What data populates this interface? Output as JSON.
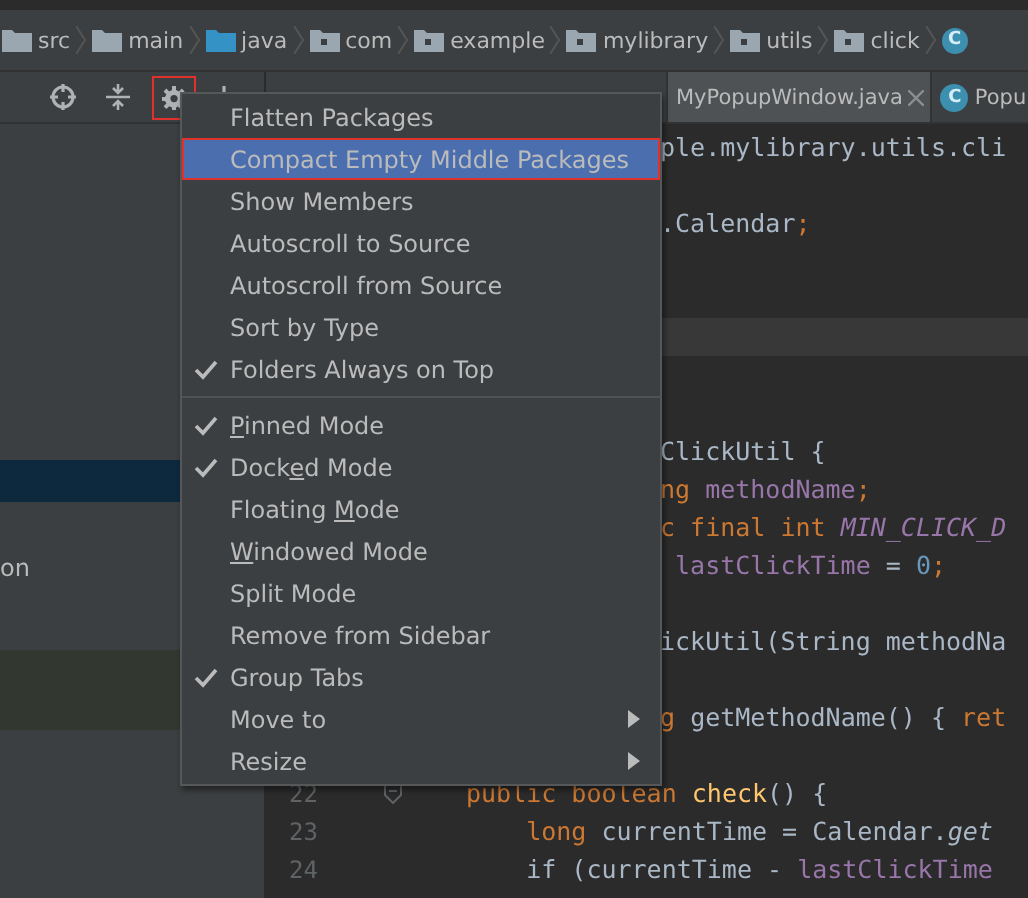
{
  "breadcrumb": [
    {
      "label": "src",
      "kind": "folder"
    },
    {
      "label": "main",
      "kind": "folder"
    },
    {
      "label": "java",
      "kind": "source-folder"
    },
    {
      "label": "com",
      "kind": "package"
    },
    {
      "label": "example",
      "kind": "package"
    },
    {
      "label": "mylibrary",
      "kind": "package"
    },
    {
      "label": "utils",
      "kind": "package"
    },
    {
      "label": "click",
      "kind": "package"
    },
    {
      "kind": "class",
      "icon_letter": "C"
    }
  ],
  "project_panel": {
    "tools": [
      {
        "kind": "locate",
        "outlined": false
      },
      {
        "kind": "collapse",
        "outlined": false
      },
      {
        "kind": "gear",
        "outlined": true
      },
      {
        "kind": "hide",
        "outlined": false
      }
    ],
    "row_text": "on"
  },
  "editor_tabs": [
    {
      "selected": false
    },
    {
      "label": "MyPopupWindow.java",
      "selected": true,
      "closable": true
    },
    {
      "label": "Popu",
      "icon_letter": "C",
      "selected": false
    }
  ],
  "code_lines": [
    {
      "kind": "covered",
      "tokens": [
        {
          "t": "ple.mylibrary.utils.cli",
          "kind": "plain"
        }
      ]
    },
    {
      "kind": "covered"
    },
    {
      "kind": "covered",
      "tokens": [
        {
          "t": ".Calendar",
          "kind": "plain"
        },
        {
          "t": ";",
          "kind": "keyword"
        }
      ]
    },
    {
      "kind": "covered"
    },
    {
      "kind": "covered"
    },
    {
      "kind": "covered",
      "current": true
    },
    {
      "kind": "covered"
    },
    {
      "kind": "covered"
    },
    {
      "kind": "covered",
      "tokens": [
        {
          "t": "ClickUtil {",
          "kind": "plain"
        }
      ]
    },
    {
      "kind": "covered",
      "tokens": [
        {
          "t": "ng ",
          "kind": "keyword"
        },
        {
          "t": "methodName",
          "kind": "field"
        },
        {
          "t": ";",
          "kind": "keyword"
        }
      ]
    },
    {
      "kind": "covered",
      "tokens": [
        {
          "t": "c final int ",
          "kind": "keyword"
        },
        {
          "t": "MIN_CLICK_D",
          "kind": "constant"
        }
      ]
    },
    {
      "kind": "covered",
      "tokens": [
        {
          "t": " lastClickTime",
          "kind": "field"
        },
        {
          "t": " = ",
          "kind": "plain"
        },
        {
          "t": "0",
          "kind": "number"
        },
        {
          "t": ";",
          "kind": "keyword"
        }
      ]
    },
    {
      "kind": "covered"
    },
    {
      "kind": "covered",
      "tokens": [
        {
          "t": "ickUtil(String methodNa",
          "kind": "plain"
        }
      ]
    },
    {
      "kind": "covered"
    },
    {
      "kind": "covered",
      "tokens": [
        {
          "t": "g ",
          "kind": "keyword"
        },
        {
          "t": "getMethodName() { ",
          "kind": "plain"
        },
        {
          "t": "ret",
          "kind": "keyword"
        }
      ]
    },
    {
      "kind": "full"
    },
    {
      "kind": "full",
      "number": "22",
      "fold": true,
      "tokens": [
        {
          "t": "public boolean ",
          "kind": "keyword"
        },
        {
          "t": "check",
          "kind": "method"
        },
        {
          "t": "() {",
          "kind": "plain"
        }
      ]
    },
    {
      "kind": "full",
      "number": "23",
      "tokens": [
        {
          "t": "    long ",
          "kind": "keyword"
        },
        {
          "t": "currentTime = Calendar.",
          "kind": "plain"
        },
        {
          "t": "get",
          "kind": "static"
        }
      ]
    },
    {
      "kind": "full",
      "number": "24",
      "tokens": [
        {
          "t": "    if (currentTime - ",
          "kind": "plain"
        },
        {
          "t": "lastClickTime",
          "kind": "field"
        }
      ]
    }
  ],
  "menu": [
    {
      "label": "Flatten Packages",
      "checked": false,
      "selected": false,
      "outlined": false
    },
    {
      "label": "Compact Empty Middle Packages",
      "checked": false,
      "selected": true,
      "outlined": true
    },
    {
      "label": "Show Members",
      "checked": false,
      "selected": false,
      "outlined": false
    },
    {
      "label": "Autoscroll to Source",
      "checked": false,
      "selected": false,
      "outlined": false
    },
    {
      "label": "Autoscroll from Source",
      "checked": false,
      "selected": false,
      "outlined": false
    },
    {
      "label": "Sort by Type",
      "checked": false,
      "selected": false,
      "outlined": false
    },
    {
      "label": "Folders Always on Top",
      "checked": true,
      "selected": false,
      "outlined": false,
      "separator_after": true
    },
    {
      "mnemonic": "P",
      "label_after": "inned Mode",
      "checked": true,
      "selected": false,
      "outlined": false
    },
    {
      "label_before": "Dock",
      "mnemonic": "e",
      "label_after": "d Mode",
      "checked": true,
      "selected": false,
      "outlined": false
    },
    {
      "label_before": "Floating ",
      "mnemonic": "M",
      "label_after": "ode",
      "checked": false,
      "selected": false,
      "outlined": false
    },
    {
      "mnemonic": "W",
      "label_after": "indowed Mode",
      "checked": false,
      "selected": false,
      "outlined": false
    },
    {
      "label": "Split Mode",
      "checked": false,
      "selected": false,
      "outlined": false
    },
    {
      "label": "Remove from Sidebar",
      "checked": false,
      "selected": false,
      "outlined": false
    },
    {
      "label": "Group Tabs",
      "checked": true,
      "selected": false,
      "outlined": false
    },
    {
      "label": "Move to",
      "checked": false,
      "selected": false,
      "outlined": false,
      "submenu": true
    },
    {
      "label": "Resize",
      "checked": false,
      "selected": false,
      "outlined": false,
      "submenu": true
    }
  ]
}
